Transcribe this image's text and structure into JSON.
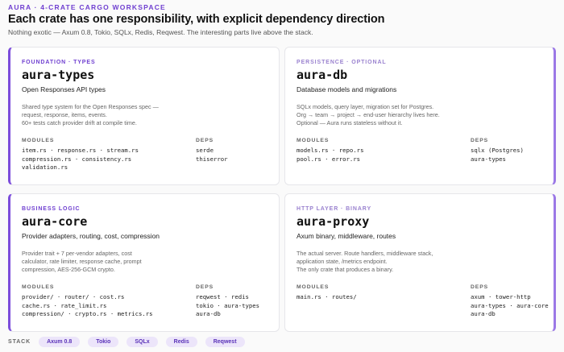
{
  "header": {
    "eyebrow": "AURA · 4-CRATE CARGO WORKSPACE",
    "title": "Each crate has one responsibility, with explicit dependency direction",
    "subtitle": "Nothing exotic — Axum 0.8, Tokio, SQLx, Redis, Reqwest. The interesting parts live above the stack."
  },
  "labels": {
    "modules": "MODULES",
    "deps": "DEPS",
    "stack": "STACK"
  },
  "cards": {
    "types": {
      "tag": "FOUNDATION · TYPES",
      "name": "aura-types",
      "tagline": "Open Responses API types",
      "desc": [
        "Shared type system for the Open Responses spec —",
        "request, response, items, events.",
        "60+ tests catch provider drift at compile time."
      ],
      "modules": [
        "item.rs · response.rs · stream.rs",
        "compression.rs · consistency.rs",
        "validation.rs"
      ],
      "deps": [
        "serde",
        "thiserror"
      ]
    },
    "db": {
      "tag": "PERSISTENCE · OPTIONAL",
      "name": "aura-db",
      "tagline": "Database models and migrations",
      "desc": [
        "SQLx models, query layer, migration set for Postgres.",
        "Org → team → project → end-user hierarchy lives here.",
        "Optional — Aura runs stateless without it."
      ],
      "modules": [
        "models.rs · repo.rs",
        "pool.rs · error.rs"
      ],
      "deps": [
        "sqlx (Postgres)",
        "aura-types"
      ]
    },
    "core": {
      "tag": "BUSINESS LOGIC",
      "name": "aura-core",
      "tagline": "Provider adapters, routing, cost, compression",
      "desc": [
        "Provider trait + 7 per-vendor adapters, cost",
        "calculator, rate limiter, response cache, prompt",
        "compression, AES-256-GCM crypto."
      ],
      "modules": [
        "provider/ · router/ · cost.rs",
        "cache.rs · rate_limit.rs",
        "compression/ · crypto.rs · metrics.rs"
      ],
      "deps": [
        "reqwest · redis",
        "tokio · aura-types",
        "aura-db"
      ]
    },
    "proxy": {
      "tag": "HTTP LAYER · BINARY",
      "name": "aura-proxy",
      "tagline": "Axum binary, middleware, routes",
      "desc": [
        "The actual server. Route handlers, middleware stack,",
        "application state, /metrics endpoint.",
        "The only crate that produces a binary."
      ],
      "modules": [
        "main.rs · routes/"
      ],
      "deps": [
        "axum · tower-http",
        "aura-types · aura-core",
        "aura-db"
      ]
    }
  },
  "stack": [
    "Axum 0.8",
    "Tokio",
    "SQLx",
    "Redis",
    "Reqwest"
  ]
}
